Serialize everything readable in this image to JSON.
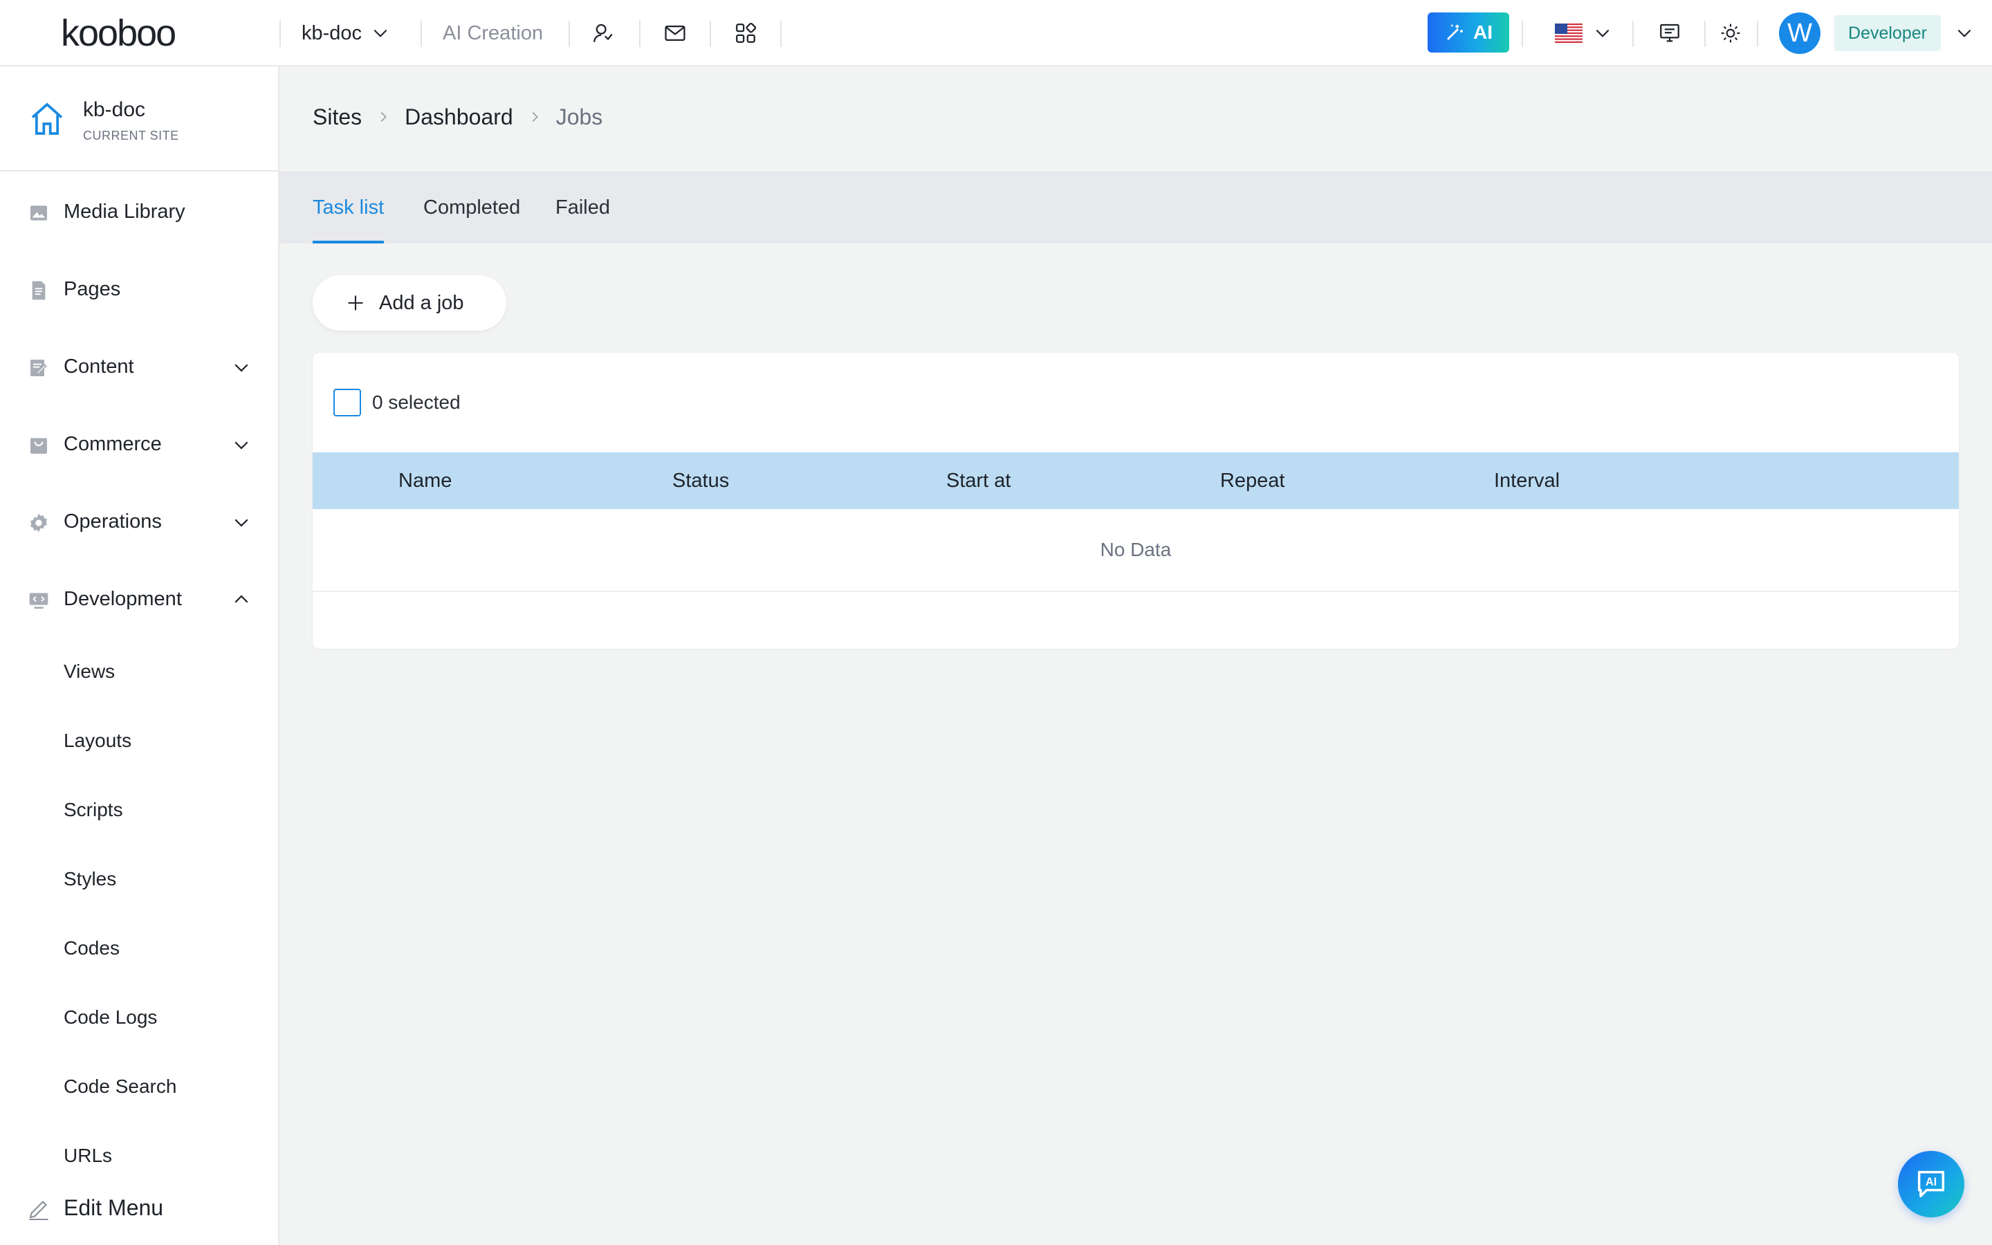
{
  "brand": {
    "logo_text": "kooboo"
  },
  "topbar": {
    "site_selector": "kb-doc",
    "ai_creation": "AI Creation",
    "ai_button": "AI",
    "avatar_initial": "W",
    "role": "Developer",
    "accent": "#1a89e0"
  },
  "sidebar": {
    "current_site": {
      "name": "kb-doc",
      "caption": "CURRENT SITE"
    },
    "items": [
      {
        "label": "Media Library",
        "icon": "image-icon"
      },
      {
        "label": "Pages",
        "icon": "document-icon"
      },
      {
        "label": "Content",
        "icon": "edit-document-icon",
        "expanded": false
      },
      {
        "label": "Commerce",
        "icon": "shopping-bag-icon",
        "expanded": false
      },
      {
        "label": "Operations",
        "icon": "gear-icon",
        "expanded": false
      },
      {
        "label": "Development",
        "icon": "code-icon",
        "expanded": true
      }
    ],
    "development_children": [
      "Views",
      "Layouts",
      "Scripts",
      "Styles",
      "Codes",
      "Code Logs",
      "Code Search",
      "URLs"
    ],
    "edit_menu": "Edit Menu"
  },
  "breadcrumb": [
    "Sites",
    "Dashboard",
    "Jobs"
  ],
  "tabs": [
    "Task list",
    "Completed",
    "Failed"
  ],
  "active_tab": "Task list",
  "toolbar": {
    "add_job": "Add a job"
  },
  "table": {
    "selected_text": "0 selected",
    "columns": [
      "Name",
      "Status",
      "Start at",
      "Repeat",
      "Interval"
    ],
    "empty_text": "No Data"
  },
  "fab": {
    "label": "AI"
  }
}
